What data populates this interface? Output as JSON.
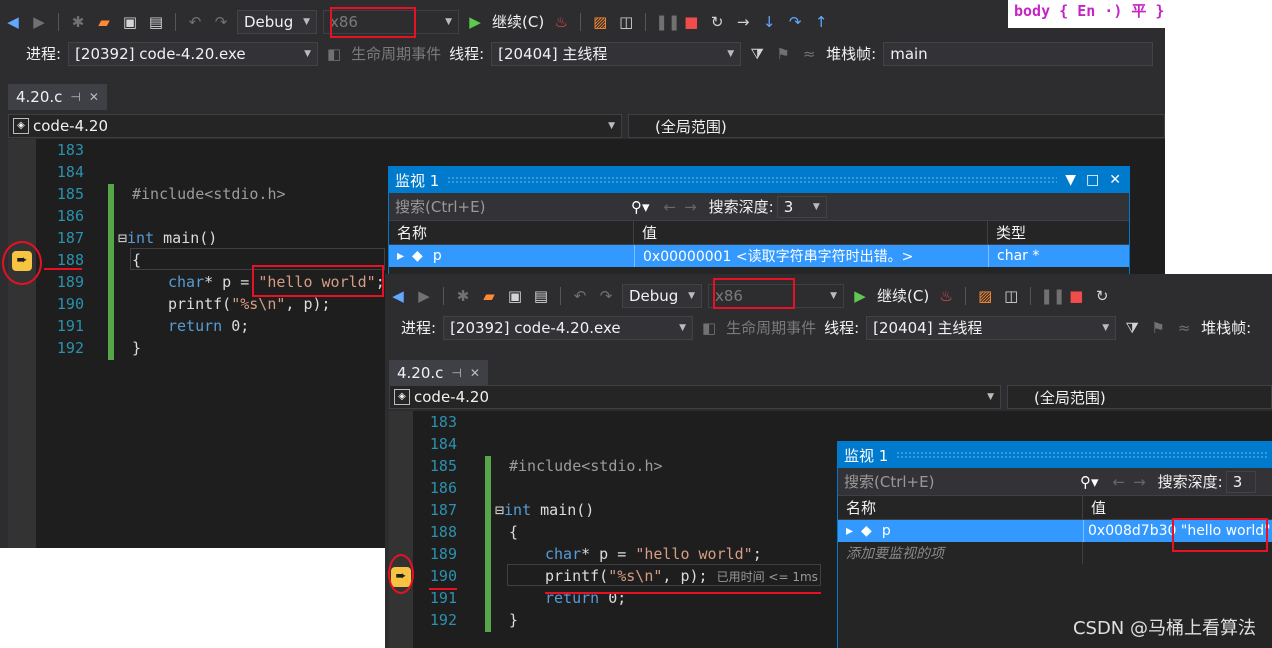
{
  "toolbar": {
    "config": "Debug",
    "platform": "x86",
    "continue_label": "继续(C)",
    "process_label": "进程:",
    "process_value": "[20392] code-4.20.exe",
    "lifecycle_label": "生命周期事件",
    "thread_label": "线程:",
    "thread_value": "[20404] 主线程",
    "stackframe_label": "堆栈帧:",
    "stackframe_value": "main"
  },
  "tab": {
    "filename": "4.20.c"
  },
  "nav": {
    "project": "code-4.20",
    "scope": "(全局范围)"
  },
  "code_lines": {
    "n183": "183",
    "n184": "184",
    "n185": "185",
    "n186": "186",
    "n187": "187",
    "n188": "188",
    "n189": "189",
    "n190": "190",
    "n191": "191",
    "n192": "192",
    "include": "#include<stdio.h>",
    "int_kw": "int",
    "main_sig": " main()",
    "brace_open": "{",
    "char_kw": "char",
    "decl_mid": "* p = ",
    "hello_str": "\"hello world\"",
    "semicolon": ";",
    "printf_fn": "printf(",
    "fmt_str": "\"%s\\n\"",
    "printf_rest": ", p);",
    "return_kw": "return",
    "return_rest": " 0;",
    "brace_close": "}",
    "elapsed": "已用时间 <= 1ms"
  },
  "watch1": {
    "title": "监视 1",
    "search_placeholder": "搜索(Ctrl+E)",
    "depth_label": "搜索深度:",
    "depth_value": "3",
    "col_name": "名称",
    "col_value": "值",
    "col_type": "类型",
    "row_name": "p",
    "row_value": "0x00000001 <读取字符串字符时出错。>",
    "row_type": "char *"
  },
  "watch2": {
    "title": "监视 1",
    "search_placeholder": "搜索(Ctrl+E)",
    "depth_label": "搜索深度:",
    "depth_value": "3",
    "col_name": "名称",
    "col_value": "值",
    "row_name": "p",
    "row_value_addr": "0x008d7b30",
    "row_value_str": "\"hello world\"",
    "add_item": "添加要监视的项"
  },
  "overlay": {
    "body_tag": "body { En ·) 平 }"
  },
  "watermark": "CSDN @马桶上看算法",
  "colors": {
    "accent": "#007acc",
    "selection": "#3399ff",
    "annotation": "#e81123",
    "breakpoint_arrow": "#f6c343"
  }
}
